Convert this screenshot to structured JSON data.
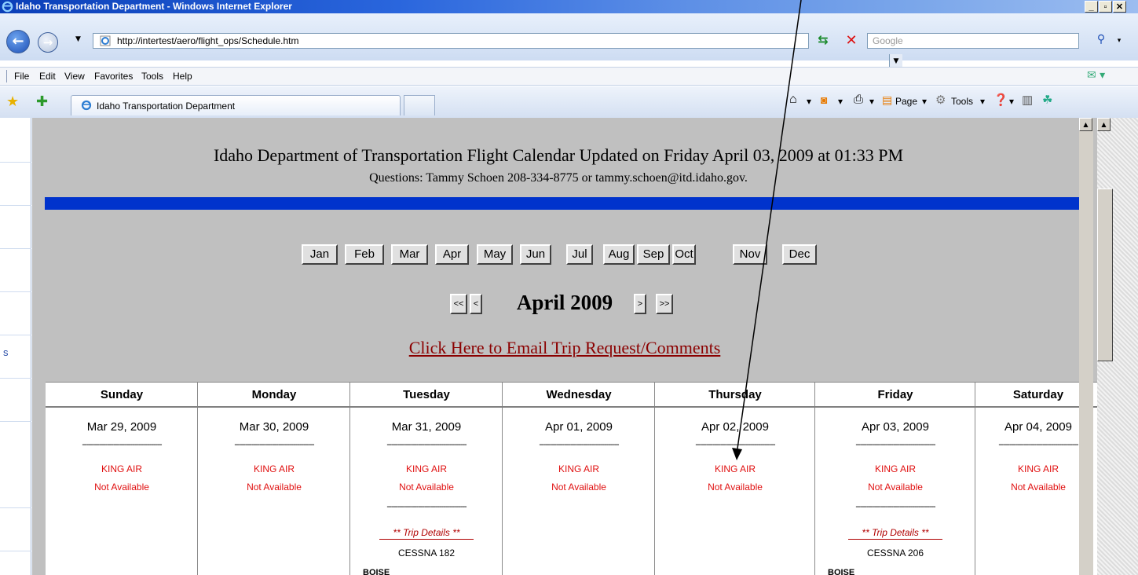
{
  "window": {
    "title": "Idaho Transportation Department - Windows Internet Explorer",
    "title_fragment_above": "part of other text that is cut off at the top of the image, not readable"
  },
  "toolbar": {
    "address": "http://intertest/aero/flight_ops/Schedule.htm",
    "search_placeholder": "Google"
  },
  "menu": [
    "File",
    "Edit",
    "View",
    "Favorites",
    "Tools",
    "Help"
  ],
  "tabs": [
    {
      "label": "Idaho Transportation Department"
    }
  ],
  "command_bar": {
    "page_label": "Page",
    "tools_label": "Tools"
  },
  "left_panel": {
    "letter": "s"
  },
  "page": {
    "title": "Idaho Department of Transportation Flight Calendar Updated on Friday April 03, 2009 at 01:33 PM",
    "subtitle": "Questions: Tammy Schoen 208-334-8775 or tammy.schoen@itd.idaho.gov.",
    "months": [
      "Jan",
      "Feb",
      "Mar",
      "Apr",
      "May",
      "Jun",
      "Jul",
      "Aug",
      "Sep",
      "Oct",
      "Nov",
      "Dec"
    ],
    "nav": {
      "prev_year": "<<",
      "prev_month": "<",
      "next_month": ">",
      "next_year": ">>"
    },
    "current_month": "April 2009",
    "email_link": "Click Here to Email Trip Request/Comments"
  },
  "calendar": {
    "days": [
      {
        "name": "Sunday",
        "date": "Mar 29, 2009",
        "aircraft": "KING AIR",
        "status": "Not Available"
      },
      {
        "name": "Monday",
        "date": "Mar 30, 2009",
        "aircraft": "KING AIR",
        "status": "Not Available"
      },
      {
        "name": "Tuesday",
        "date": "Mar 31, 2009",
        "aircraft": "KING AIR",
        "status": "Not Available",
        "trip": {
          "label": "** Trip Details **",
          "plane": "CESSNA 182",
          "dest": "BOISE"
        }
      },
      {
        "name": "Wednesday",
        "date": "Apr 01, 2009",
        "aircraft": "KING AIR",
        "status": "Not Available"
      },
      {
        "name": "Thursday",
        "date": "Apr 02, 2009",
        "aircraft": "KING AIR",
        "status": "Not Available"
      },
      {
        "name": "Friday",
        "date": "Apr 03, 2009",
        "aircraft": "KING AIR",
        "status": "Not Available",
        "trip": {
          "label": "** Trip Details **",
          "plane": "CESSNA 206",
          "dest": "BOISE"
        }
      },
      {
        "name": "Saturday",
        "date": "Apr 04, 2009",
        "aircraft": "KING AIR",
        "status": "Not Available"
      }
    ],
    "separator": "--------------------------------------"
  },
  "colors": {
    "titlebar": "#0a3fb8",
    "page_bg": "#c0c0c0",
    "blue_rule": "#0033cc",
    "link": "#8b0000",
    "unavailable": "#e01010"
  }
}
